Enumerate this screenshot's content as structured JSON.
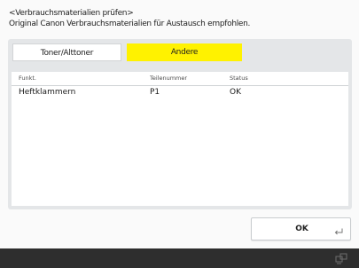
{
  "header": {
    "title": "<Verbrauchsmaterialien prüfen>",
    "message": "Original Canon Verbrauchsmaterialien für Austausch empfohlen."
  },
  "tabs": [
    {
      "label": "Toner/Alttoner",
      "selected": false
    },
    {
      "label": "Andere",
      "selected": true
    }
  ],
  "table": {
    "columns": [
      "Funkt.",
      "Teilenummer",
      "Status"
    ],
    "rows": [
      {
        "name": "Heftklammern",
        "part": "P1",
        "status": "OK"
      }
    ]
  },
  "ok_button": {
    "label": "OK",
    "icon": "enter-icon"
  },
  "footer": {
    "icon": "network-icon"
  },
  "colors": {
    "selected_tab": "#fff200",
    "panel": "#e4e6e8",
    "footer": "#2e2e2e"
  }
}
